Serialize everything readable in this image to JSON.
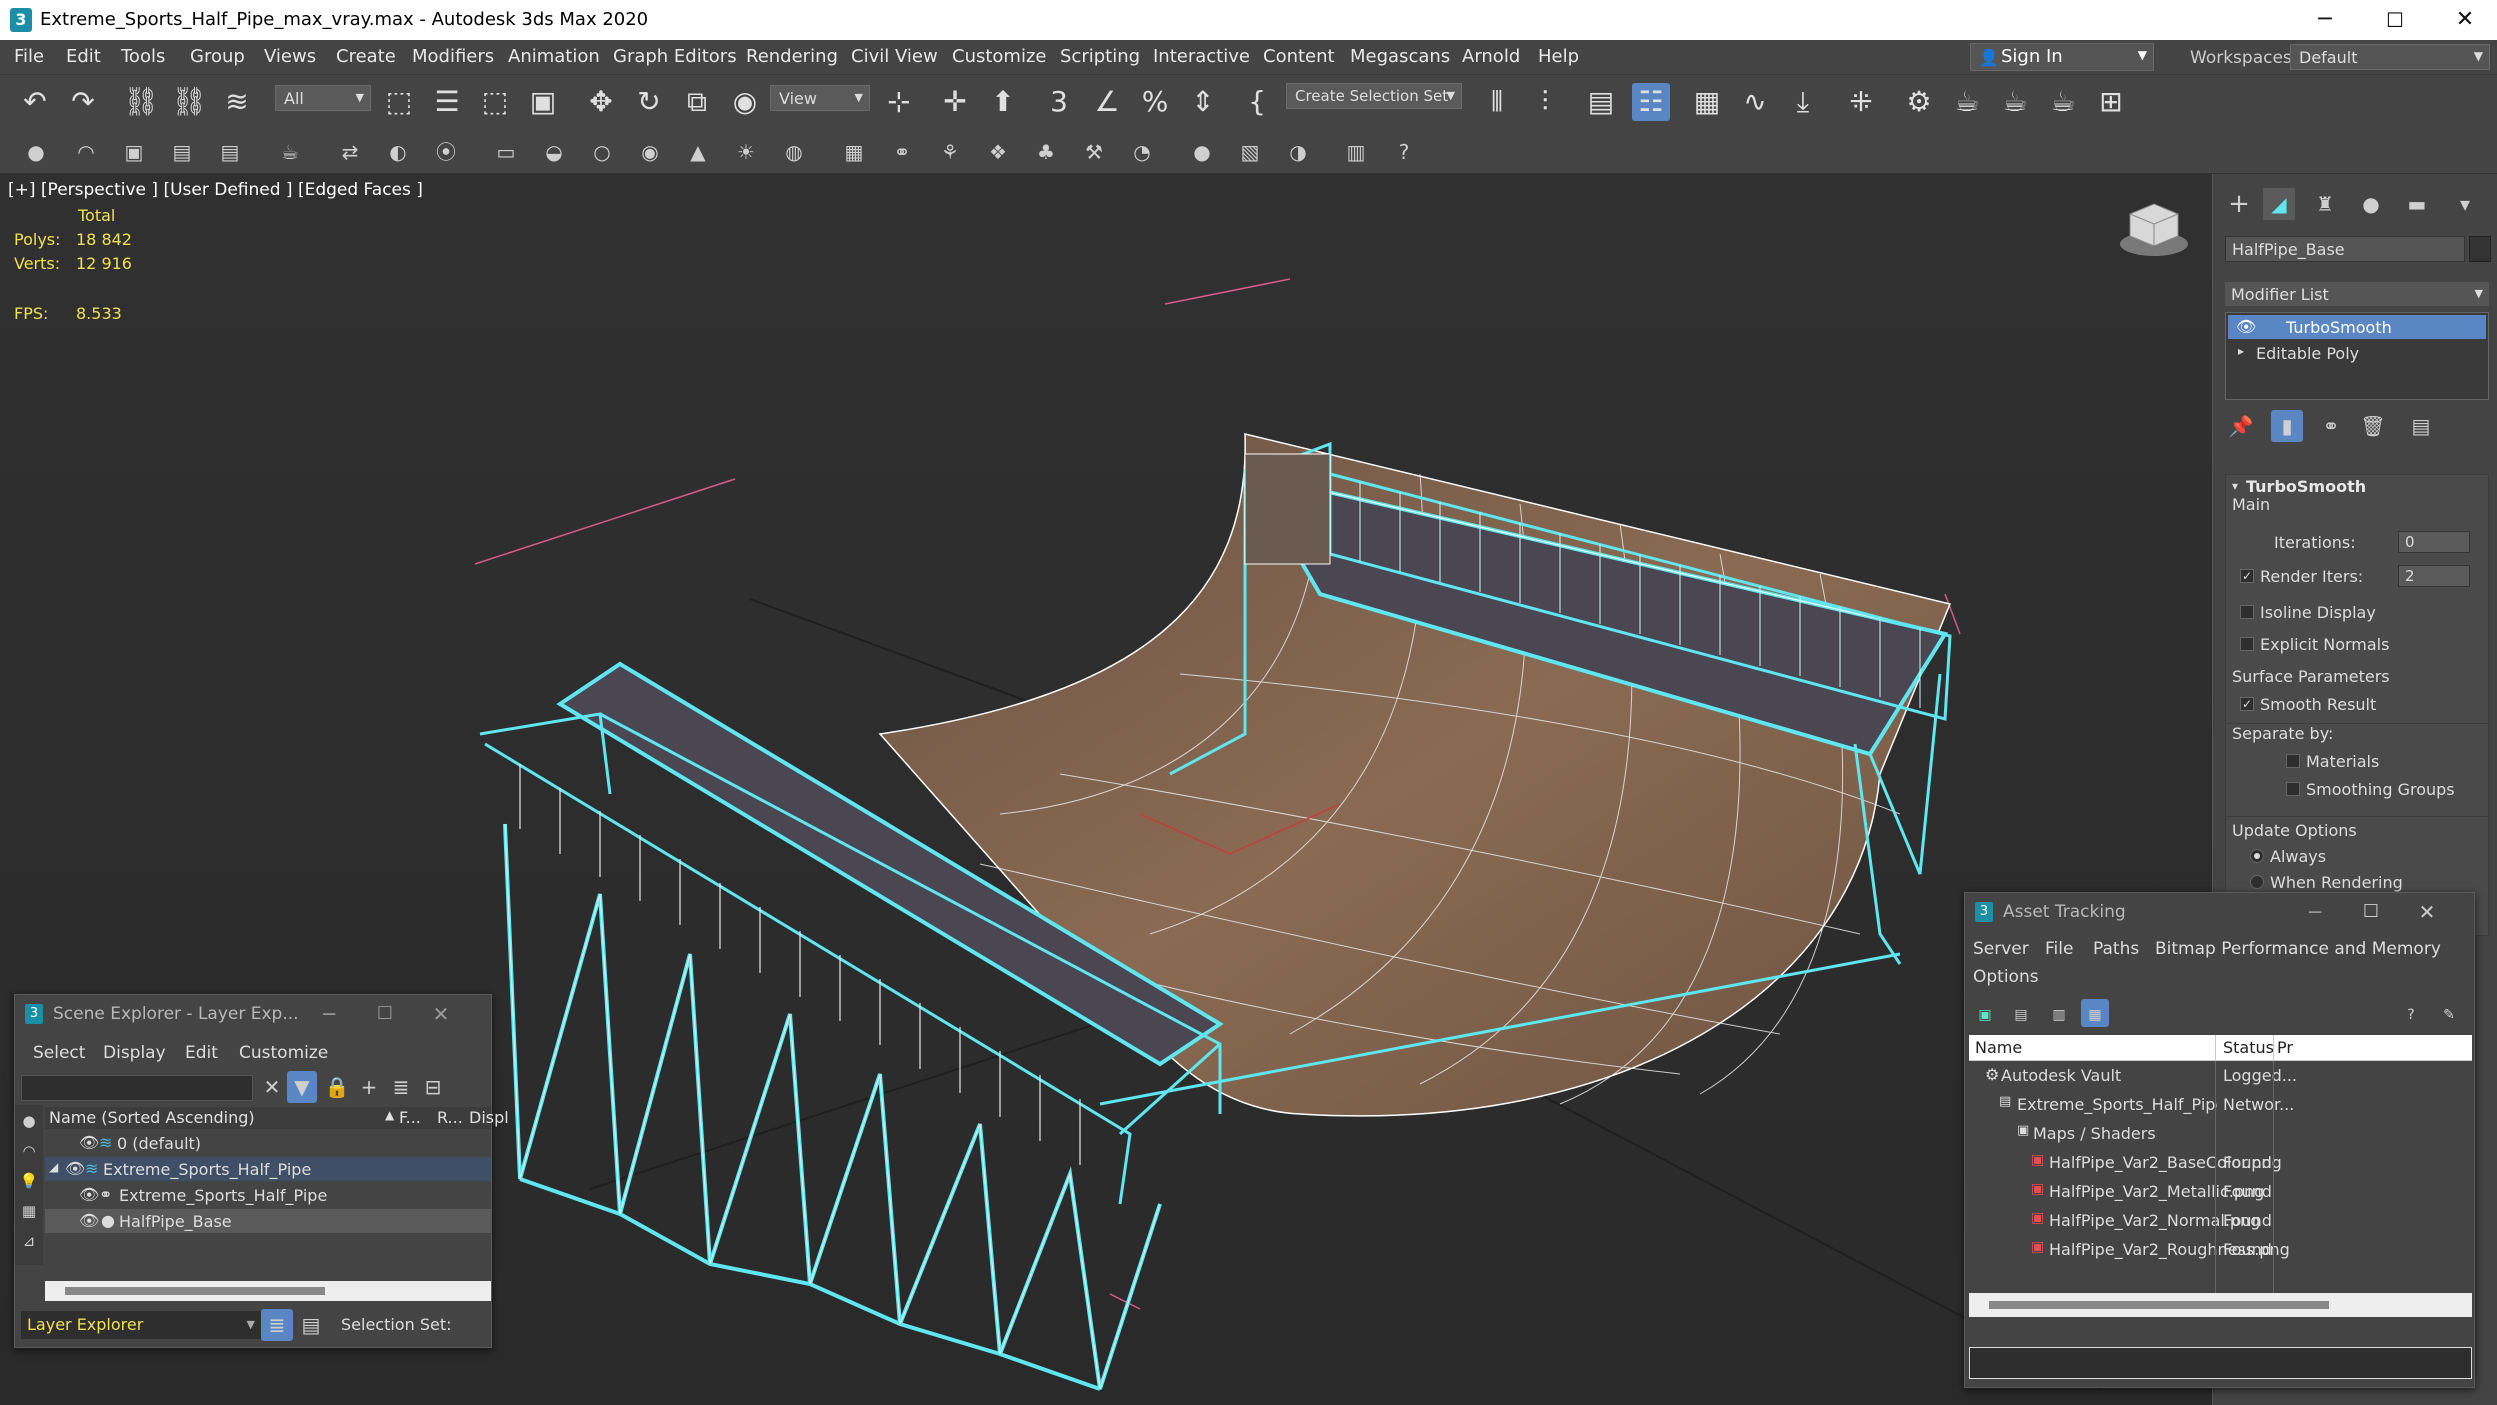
{
  "window": {
    "title": "Extreme_Sports_Half_Pipe_max_vray.max - Autodesk 3ds Max 2020",
    "logo": "3",
    "minimize": "─",
    "maximize": "☐",
    "close": "✕"
  },
  "menu": [
    "File",
    "Edit",
    "Tools",
    "Group",
    "Views",
    "Create",
    "Modifiers",
    "Animation",
    "Graph Editors",
    "Rendering",
    "Civil View",
    "Customize",
    "Scripting",
    "Interactive",
    "Content",
    "Megascans",
    "Arnold",
    "Help"
  ],
  "account": {
    "sign_in": "Sign In",
    "workspaces_label": "Workspaces:",
    "workspace": "Default"
  },
  "toolbar": {
    "filter": "All",
    "ref_coord": "View",
    "selection_set": "Create Selection Set"
  },
  "viewport": {
    "label": "[+] [Perspective ] [User Defined ] [Edged Faces ]",
    "stats_header": "Total",
    "polys_label": "Polys:",
    "polys": "18 842",
    "verts_label": "Verts:",
    "verts": "12 916",
    "fps_label": "FPS:",
    "fps": "8.533"
  },
  "command_panel": {
    "object_name": "HalfPipe_Base",
    "modifier_list": "Modifier List",
    "stack": [
      "TurboSmooth",
      "Editable Poly"
    ],
    "rollout_title": "TurboSmooth",
    "main": "Main",
    "iterations_label": "Iterations:",
    "iterations": "0",
    "render_iters_label": "Render Iters:",
    "render_iters": "2",
    "isoline": "Isoline Display",
    "explicit_normals": "Explicit Normals",
    "surface_params": "Surface Parameters",
    "smooth_result": "Smooth Result",
    "separate_by": "Separate by:",
    "materials": "Materials",
    "smoothing_groups": "Smoothing Groups",
    "update_options": "Update Options",
    "always": "Always",
    "when_rendering": "When Rendering"
  },
  "scene_explorer": {
    "title": "Scene Explorer - Layer Exp...",
    "menu": [
      "Select",
      "Display",
      "Edit",
      "Customize"
    ],
    "col_name": "Name (Sorted Ascending)",
    "col_f": "F...",
    "col_r": "R...",
    "col_displ": "Displ",
    "rows": [
      "0 (default)",
      "Extreme_Sports_Half_Pipe",
      "Extreme_Sports_Half_Pipe",
      "HalfPipe_Base"
    ],
    "footer_label": "Layer Explorer",
    "selection_set": "Selection Set:"
  },
  "asset_tracking": {
    "title": "Asset Tracking",
    "menu": [
      "Server",
      "File",
      "Paths",
      "Bitmap Performance and Memory",
      "Options"
    ],
    "col_name": "Name",
    "col_status": "Status",
    "col_p": "Pr",
    "rows": [
      {
        "name": "Autodesk Vault",
        "status": "Logged..."
      },
      {
        "name": "Extreme_Sports_Half_Pipe_max_vray.max",
        "status": "Networ..."
      },
      {
        "name": "Maps / Shaders",
        "status": ""
      },
      {
        "name": "HalfPipe_Var2_BaseColor.png",
        "status": "Found"
      },
      {
        "name": "HalfPipe_Var2_Metallic.png",
        "status": "Found"
      },
      {
        "name": "HalfPipe_Var2_Normal.png",
        "status": "Found"
      },
      {
        "name": "HalfPipe_Var2_Roughness.png",
        "status": "Found"
      }
    ]
  },
  "colors": {
    "accent": "#5a87c4",
    "selection_wire": "#5fe6f0",
    "stats": "#f2e14c"
  }
}
